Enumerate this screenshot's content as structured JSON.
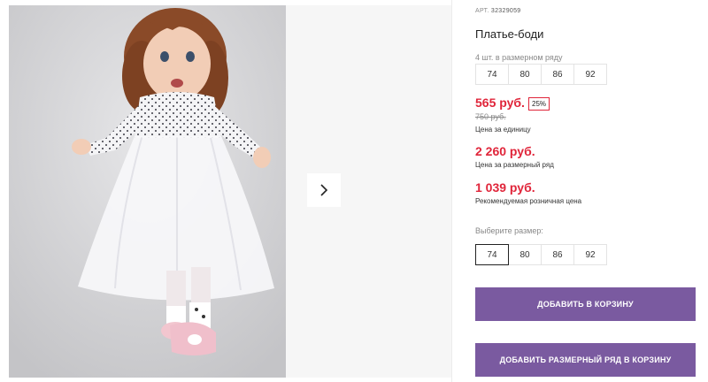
{
  "product": {
    "article_label": "АРТ.",
    "article_number": "32329059",
    "title": "Платье-боди"
  },
  "size_range": {
    "label": "4 шт. в размерном ряду",
    "sizes": [
      "74",
      "80",
      "86",
      "92"
    ]
  },
  "prices": {
    "unit_price": "565 руб.",
    "discount_badge": "25%",
    "old_price": "750 руб.",
    "unit_caption": "Цена за единицу",
    "range_price": "2 260 руб.",
    "range_caption": "Цена за размерный ряд",
    "retail_price": "1 039 руб.",
    "retail_caption": "Рекомендуемая розничная цена"
  },
  "size_select": {
    "label": "Выберите размер:",
    "sizes": [
      "74",
      "80",
      "86",
      "92"
    ],
    "selected": "74"
  },
  "actions": {
    "add_to_cart": "ДОБАВИТЬ В КОРЗИНУ",
    "add_range_to_cart": "ДОБАВИТЬ РАЗМЕРНЫЙ РЯД В КОРЗИНУ"
  },
  "colors": {
    "price_red": "#e0253a",
    "button_purple": "#7a5aa0"
  },
  "icons": {
    "next": "chevron-right-icon"
  }
}
